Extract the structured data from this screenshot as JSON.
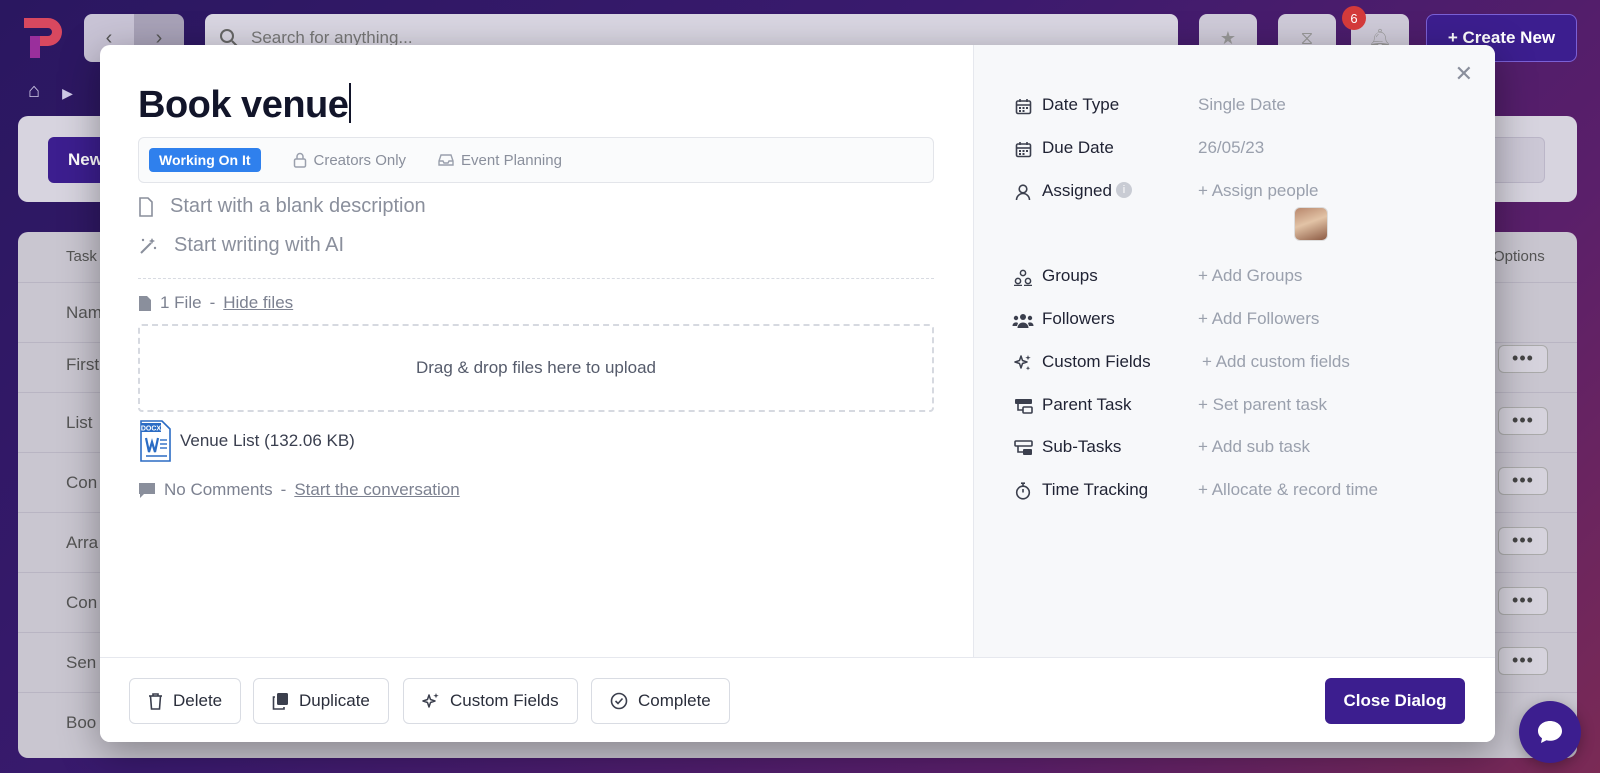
{
  "background": {
    "search_placeholder": "Search for anything...",
    "notification_count": "6",
    "create_label": "+ Create New",
    "new_label": "New",
    "table": {
      "header_task": "Task",
      "header_options": "Options",
      "rows": [
        "Nam",
        "First",
        "List",
        "Con",
        "Arra",
        "Con",
        "Sen",
        "Boo"
      ]
    }
  },
  "task": {
    "title": "Book venue",
    "status": "Working On It",
    "visibility": "Creators Only",
    "project": "Event Planning",
    "blank_description": "Start with a blank description",
    "ai_description": "Start writing with AI",
    "files_count": "1 File",
    "files_separator": "-",
    "hide_files": "Hide files",
    "dropzone": "Drag & drop files here to upload",
    "file_name": "Venue List (132.06 KB)",
    "file_type_badge": "DOCX",
    "comments": "No Comments",
    "comments_separator": "-",
    "start_conversation": "Start the conversation"
  },
  "properties": [
    {
      "icon": "calendar-icon",
      "label": "Date Type",
      "value": "Single Date"
    },
    {
      "icon": "calendar-icon",
      "label": "Due Date",
      "value": "26/05/23"
    },
    {
      "icon": "user-icon",
      "label": "Assigned",
      "value": "+ Assign people"
    },
    {
      "icon": "groups-icon",
      "label": "Groups",
      "value": "+ Add Groups"
    },
    {
      "icon": "followers-icon",
      "label": "Followers",
      "value": "+ Add Followers"
    },
    {
      "icon": "sparkles-icon",
      "label": "Custom Fields",
      "value": "+ Add custom fields"
    },
    {
      "icon": "parent-task-icon",
      "label": "Parent Task",
      "value": "+ Set parent task"
    },
    {
      "icon": "subtask-icon",
      "label": "Sub-Tasks",
      "value": "+ Add sub task"
    },
    {
      "icon": "stopwatch-icon",
      "label": "Time Tracking",
      "value": "+ Allocate & record time"
    }
  ],
  "footer": {
    "delete": "Delete",
    "duplicate": "Duplicate",
    "custom_fields": "Custom Fields",
    "complete": "Complete",
    "close_dialog": "Close Dialog"
  },
  "colors": {
    "accent": "#3c1e8f",
    "status": "#2f80ed"
  }
}
